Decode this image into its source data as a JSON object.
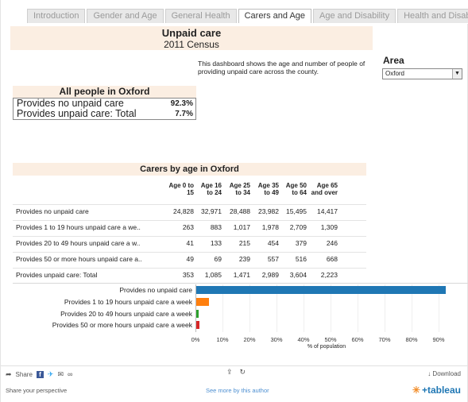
{
  "tabs": [
    {
      "label": "Introduction"
    },
    {
      "label": "Gender and Age"
    },
    {
      "label": "General Health"
    },
    {
      "label": "Carers and Age"
    },
    {
      "label": "Age and Disability"
    },
    {
      "label": "Health and Disability"
    }
  ],
  "header": {
    "title": "Unpaid care",
    "subtitle": "2011 Census"
  },
  "description": "This dashboard shows the age and number of people of providing unpaid care across the county.",
  "area": {
    "label": "Area",
    "selected": "Oxford"
  },
  "all_people": {
    "title": "All people in Oxford",
    "rows": [
      {
        "label": "Provides no unpaid care",
        "value": "92.3%"
      },
      {
        "label": "Provides unpaid care: Total",
        "value": "7.7%"
      }
    ]
  },
  "carers": {
    "title": "Carers by age in Oxford",
    "columns": [
      {
        "l1": "Age 0 to",
        "l2": "15"
      },
      {
        "l1": "Age 16",
        "l2": "to 24"
      },
      {
        "l1": "Age 25",
        "l2": "to 34"
      },
      {
        "l1": "Age 35",
        "l2": "to 49"
      },
      {
        "l1": "Age 50",
        "l2": "to 64"
      },
      {
        "l1": "Age 65",
        "l2": "and over"
      }
    ],
    "rows": [
      {
        "label": "Provides no unpaid care",
        "values": [
          "24,828",
          "32,971",
          "28,488",
          "23,982",
          "15,495",
          "14,417"
        ]
      },
      {
        "label": "Provides 1 to 19 hours unpaid care a we..",
        "values": [
          "263",
          "883",
          "1,017",
          "1,978",
          "2,709",
          "1,309"
        ]
      },
      {
        "label": "Provides 20 to 49 hours unpaid care a w..",
        "values": [
          "41",
          "133",
          "215",
          "454",
          "379",
          "246"
        ]
      },
      {
        "label": "Provides 50 or more hours unpaid care a..",
        "values": [
          "49",
          "69",
          "239",
          "557",
          "516",
          "668"
        ]
      },
      {
        "label": "Provides unpaid care: Total",
        "values": [
          "353",
          "1,085",
          "1,471",
          "2,989",
          "3,604",
          "2,223"
        ]
      }
    ]
  },
  "chart_data": {
    "type": "bar",
    "orientation": "horizontal",
    "categories": [
      "Provides no unpaid care",
      "Provides 1 to 19 hours unpaid care a week",
      "Provides 20 to 49 hours unpaid care a week",
      "Provides 50 or more hours unpaid care a week"
    ],
    "values": [
      92.3,
      4.8,
      0.9,
      1.2
    ],
    "colors": [
      "#1f77b4",
      "#ff7f0e",
      "#2ca02c",
      "#d62728"
    ],
    "xlabel": "% of population",
    "xlim": [
      0,
      95
    ],
    "xticks": [
      "0%",
      "10%",
      "20%",
      "30%",
      "40%",
      "50%",
      "60%",
      "70%",
      "80%",
      "90%"
    ]
  },
  "footer": {
    "share": "Share",
    "download": "Download",
    "perspective": "Share your perspective",
    "see_more": "See more by this author",
    "brand": "+tableau"
  }
}
